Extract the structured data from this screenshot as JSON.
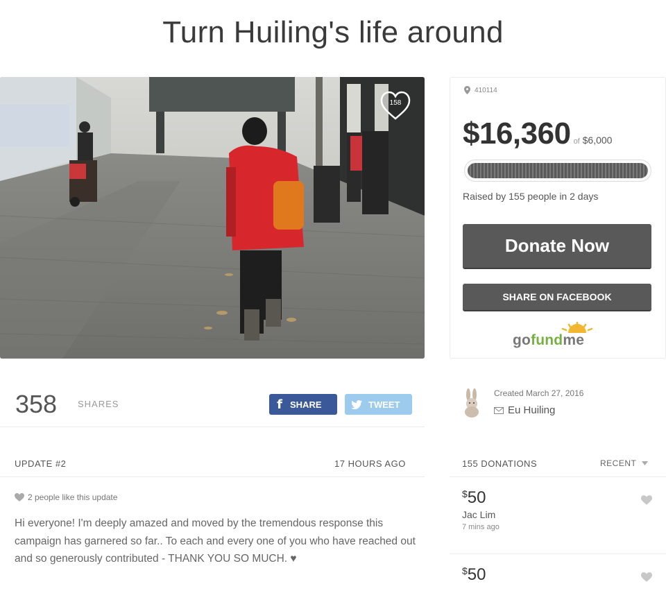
{
  "campaign": {
    "title": "Turn Huiling's life around",
    "photo_likes": "158"
  },
  "panel": {
    "zip": "410114",
    "amount_raised": "$16,360",
    "goal_prefix": "of",
    "goal": "$6,000",
    "progress_fraction": 1.0,
    "raised_by": "Raised by 155 people in 2 days",
    "donate_label": "Donate Now",
    "facebook_label": "SHARE ON FACEBOOK",
    "logo": {
      "part1": "go",
      "part2": "fund",
      "part3": "me"
    }
  },
  "shares": {
    "count": "358",
    "label": "SHARES",
    "fb_label": "SHARE",
    "tw_label": "TWEET"
  },
  "creator": {
    "created": "Created March 27, 2016",
    "name": "Eu Huiling"
  },
  "update": {
    "title": "UPDATE #2",
    "time": "17 HOURS AGO",
    "likes": "2 people like this update",
    "body": "Hi everyone! I'm deeply amazed and moved by the tremendous response this campaign has garnered so far.. To each and every one of you who have reached out and so generously contributed - THANK YOU SO MUCH. ♥"
  },
  "donations": {
    "count_label": "155 DONATIONS",
    "sort_label": "RECENT",
    "items": [
      {
        "currency": "$",
        "amount": "50",
        "name": "Jac Lim",
        "ago": "7 mins ago"
      },
      {
        "currency": "$",
        "amount": "50",
        "name": "",
        "ago": ""
      }
    ]
  },
  "colors": {
    "button": "#595959",
    "facebook": "#3b5998",
    "twitter": "#9ccbee",
    "gofundme_green": "#76b043"
  }
}
